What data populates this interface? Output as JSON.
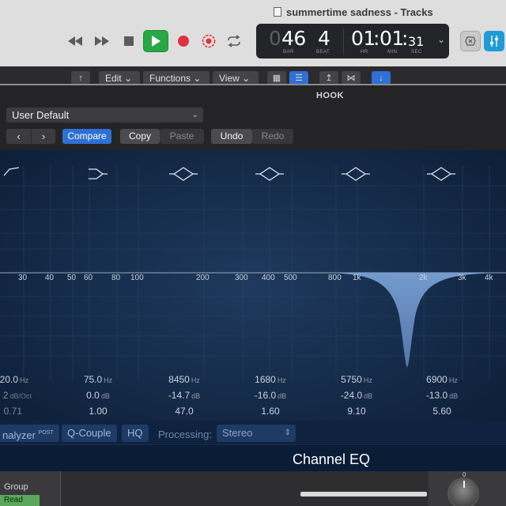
{
  "window": {
    "title": "summertime sadness - Tracks"
  },
  "transport": {
    "buttons": [
      "rewind",
      "fast-forward",
      "stop",
      "play",
      "record",
      "replace-record",
      "cycle"
    ]
  },
  "lcd": {
    "bar": "46",
    "bar_ghost": "0",
    "beat": "4",
    "hr": "01",
    "min": "01",
    "sec": "31",
    "bar_cap": "BAR",
    "beat_cap": "BEAT",
    "hr_cap": "HR",
    "min_cap": "MIN",
    "sec_cap": "SEC"
  },
  "menu": {
    "edit": "Edit",
    "functions": "Functions",
    "view": "View"
  },
  "plugin": {
    "track_name": "HOOK",
    "preset": "User Default",
    "compare": "Compare",
    "copy": "Copy",
    "paste": "Paste",
    "undo": "Undo",
    "redo": "Redo",
    "name": "Channel EQ"
  },
  "graph": {
    "freq_labels": [
      "30",
      "40",
      "50",
      "60",
      "80",
      "100",
      "200",
      "300",
      "400",
      "500",
      "800",
      "1k",
      "2k",
      "3k",
      "4k"
    ]
  },
  "bands": [
    {
      "freq": "20.0",
      "freq_unit": "Hz",
      "gain": "2",
      "gain_unit": "dB/Oct",
      "q": "0.71"
    },
    {
      "freq": "75.0",
      "freq_unit": "Hz",
      "gain": "0.0",
      "gain_unit": "dB",
      "q": "1.00"
    },
    {
      "freq": "8450",
      "freq_unit": "Hz",
      "gain": "-14.7",
      "gain_unit": "dB",
      "q": "47.0"
    },
    {
      "freq": "1680",
      "freq_unit": "Hz",
      "gain": "-16.0",
      "gain_unit": "dB",
      "q": "1.60"
    },
    {
      "freq": "5750",
      "freq_unit": "Hz",
      "gain": "-24.0",
      "gain_unit": "dB",
      "q": "9.10"
    },
    {
      "freq": "6900",
      "freq_unit": "Hz",
      "gain": "-13.0",
      "gain_unit": "dB",
      "q": "5.60"
    }
  ],
  "bottom": {
    "analyzer": "nalyzer",
    "analyzer_sup": "POST",
    "qcouple": "Q-Couple",
    "hq": "HQ",
    "processing_label": "Processing:",
    "processing_value": "Stereo"
  },
  "mixer": {
    "group": "Group",
    "read": "Read",
    "knob_zero": "0"
  },
  "colors": {
    "accent": "#2f6fd6",
    "play": "#27a844",
    "record": "#e0323c",
    "eq_fill": "#6f93c4"
  }
}
